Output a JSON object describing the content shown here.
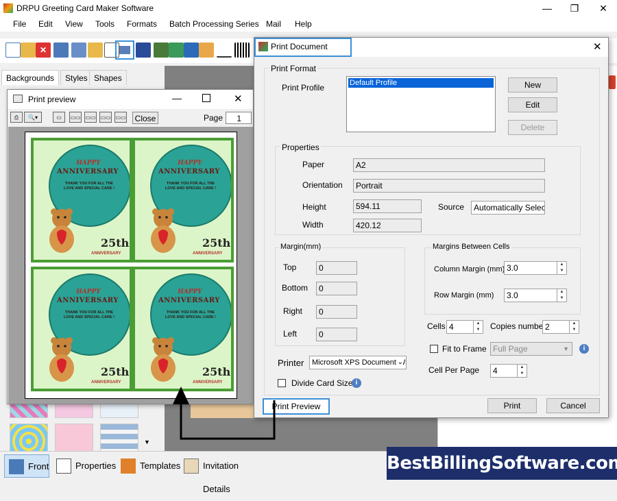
{
  "app": {
    "title": "DRPU Greeting Card Maker Software",
    "window_buttons": {
      "minimize": "—",
      "maximize": "❐",
      "close": "✕"
    }
  },
  "menu": [
    "File",
    "Edit",
    "View",
    "Tools",
    "Formats",
    "Batch Processing Series",
    "Mail",
    "Help"
  ],
  "left_panel": {
    "tabs": [
      "Backgrounds",
      "Styles",
      "Shapes"
    ]
  },
  "print_preview": {
    "title": "Print preview",
    "close_label": "Close",
    "page_label": "Page",
    "page_value": "1",
    "card": {
      "happy": "HAPPY",
      "anniversary": "ANNIVERSARY",
      "thank_you_1": "THANK YOU FOR ALL THE",
      "thank_you_2": "LOVE AND SPECIAL CARE !",
      "number": "25th",
      "anniversary_small": "ANNIVERSARY"
    }
  },
  "print_document": {
    "title": "Print Document",
    "print_format": "Print Format",
    "print_profile_label": "Print Profile",
    "profiles": [
      "Default Profile"
    ],
    "buttons": {
      "new": "New",
      "edit": "Edit",
      "delete": "Delete",
      "print": "Print",
      "cancel": "Cancel"
    },
    "properties": {
      "legend": "Properties",
      "paper_label": "Paper",
      "paper": "A2",
      "orientation_label": "Orientation",
      "orientation": "Portrait",
      "height_label": "Height",
      "height": "594.11",
      "width_label": "Width",
      "width": "420.12",
      "source_label": "Source",
      "source": "Automatically Select"
    },
    "margin": {
      "legend": "Margin(mm)",
      "top_label": "Top",
      "top": "0",
      "bottom_label": "Bottom",
      "bottom": "0",
      "right_label": "Right",
      "right": "0",
      "left_label": "Left",
      "left": "0"
    },
    "cells_margin": {
      "legend": "Margins Between Cells",
      "column_label": "Column Margin (mm)",
      "column": "3.0",
      "row_label": "Row Margin (mm)",
      "row": "3.0"
    },
    "cells_label": "Cells",
    "cells": "4",
    "copies_label": "Copies number",
    "copies": "2",
    "fit_to_frame_label": "Fit to Frame",
    "fit_value": "Full Page",
    "cell_per_page_label": "Cell Per Page",
    "cell_per_page": "4",
    "printer_label": "Printer",
    "printer": "Microsoft XPS Document Writer",
    "divide_label": "Divide Card Size",
    "print_preview_button": "Print Preview"
  },
  "bottom_tabs": [
    "Front",
    "Properties",
    "Templates",
    "Invitation Details"
  ],
  "brand": "BestBillingSoftware.com"
}
